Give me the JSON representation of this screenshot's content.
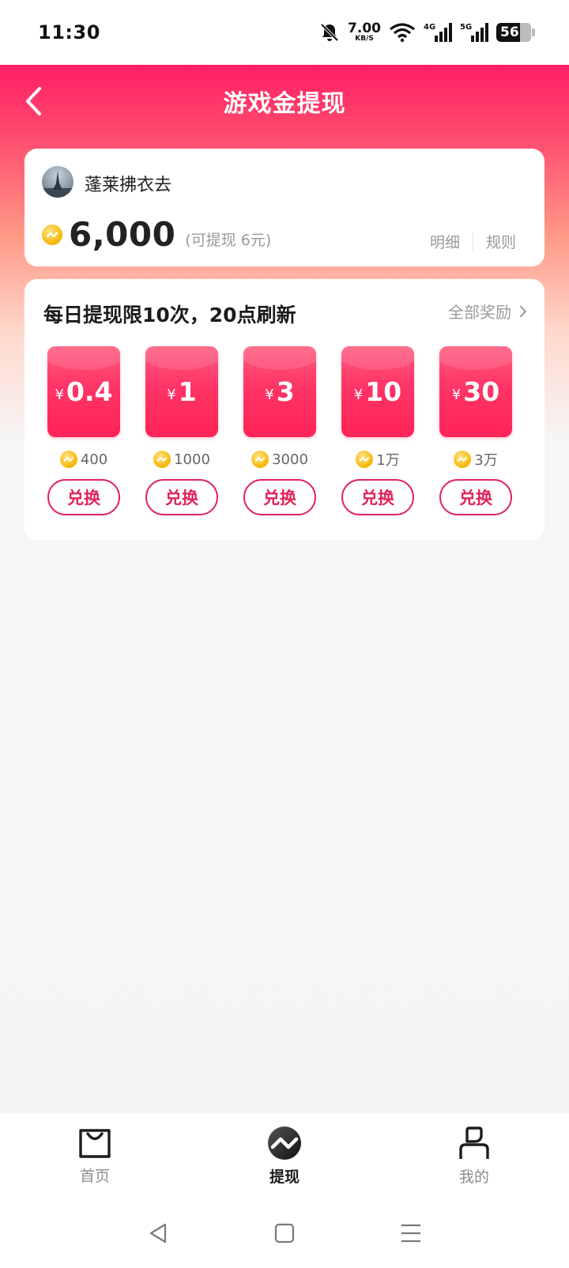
{
  "status_bar": {
    "time": "11:30",
    "net_speed": "7.00",
    "net_unit": "KB/S",
    "signal_1": "4G",
    "signal_2": "5G",
    "battery": "56"
  },
  "header": {
    "title": "游戏金提现"
  },
  "user_card": {
    "username": "蓬莱拂衣去",
    "balance": "6,000",
    "withdrawable_note": "(可提现 6元)",
    "detail_link": "明细",
    "rules_link": "规则"
  },
  "rewards": {
    "title": "每日提现限10次，20点刷新",
    "all_rewards_link": "全部奖励",
    "items": [
      {
        "currency": "¥",
        "amount": "0.4",
        "cost": "400",
        "button": "兑换"
      },
      {
        "currency": "¥",
        "amount": "1",
        "cost": "1000",
        "button": "兑换"
      },
      {
        "currency": "¥",
        "amount": "3",
        "cost": "3000",
        "button": "兑换"
      },
      {
        "currency": "¥",
        "amount": "10",
        "cost": "1万",
        "button": "兑换"
      },
      {
        "currency": "¥",
        "amount": "30",
        "cost": "3万",
        "button": "兑换"
      }
    ]
  },
  "tab_bar": {
    "tabs": [
      {
        "label": "首页",
        "icon": "shopping-bag-icon",
        "active": false
      },
      {
        "label": "提现",
        "icon": "withdraw-icon",
        "active": true
      },
      {
        "label": "我的",
        "icon": "profile-icon",
        "active": false
      }
    ]
  },
  "colors": {
    "brand_pink": "#ff1f64",
    "button_red": "#e0245a",
    "coin_gold": "#f7b500"
  }
}
